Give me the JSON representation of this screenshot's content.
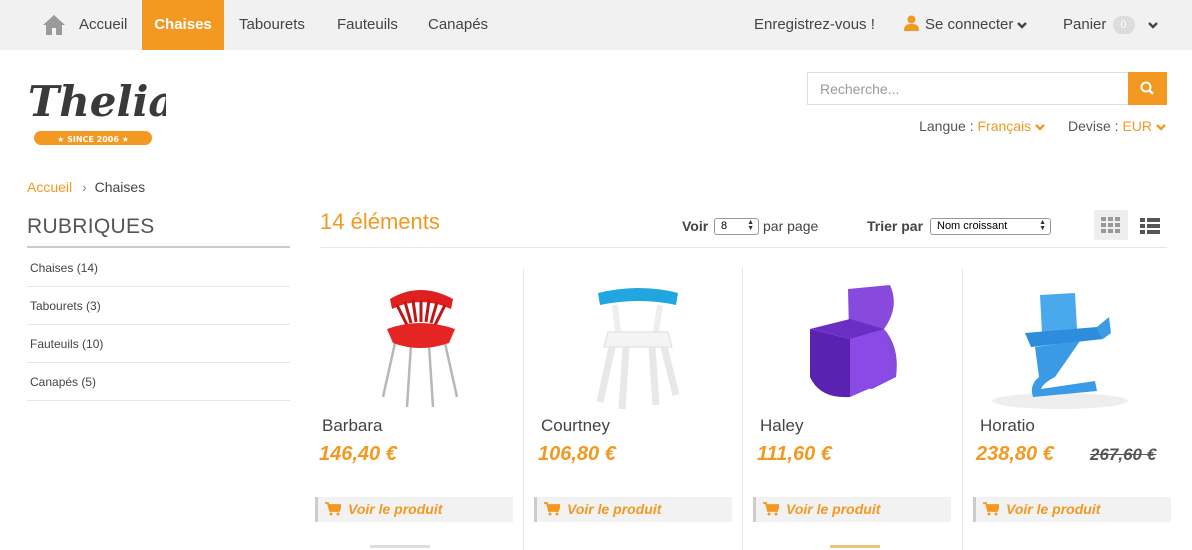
{
  "nav": {
    "home": "Accueil",
    "items": [
      "Chaises",
      "Tabourets",
      "Fauteuils",
      "Canapés"
    ],
    "register": "Enregistrez-vous !",
    "login": "Se connecter",
    "cart": "Panier",
    "cart_count": "0"
  },
  "logo": {
    "name": "Thelia",
    "tagline": "★ SINCE 2006 ★"
  },
  "search": {
    "placeholder": "Recherche..."
  },
  "lang": {
    "label": "Langue :",
    "value": "Français",
    "currency_label": "Devise :",
    "currency_value": "EUR"
  },
  "breadcrumb": {
    "home": "Accueil",
    "current": "Chaises"
  },
  "sidebar": {
    "title": "RUBRIQUES",
    "items": [
      "Chaises (14)",
      "Tabourets (3)",
      "Fauteuils (10)",
      "Canapés (5)"
    ]
  },
  "toolbar": {
    "count": "14 éléments",
    "view_label": "Voir",
    "per_page_value": "8",
    "per_page_label": "par page",
    "sort_label": "Trier par",
    "sort_value": "Nom croissant"
  },
  "products": [
    {
      "name": "Barbara",
      "price": "146,40 €",
      "old_price": "",
      "button": "Voir le produit"
    },
    {
      "name": "Courtney",
      "price": "106,80 €",
      "old_price": "",
      "button": "Voir le produit"
    },
    {
      "name": "Haley",
      "price": "111,60 €",
      "old_price": "",
      "button": "Voir le produit"
    },
    {
      "name": "Horatio",
      "price": "238,80 €",
      "old_price": "267,60 €",
      "button": "Voir le produit"
    }
  ],
  "colors": {
    "accent": "#f39922",
    "nav_bg": "#f1f1f1"
  }
}
